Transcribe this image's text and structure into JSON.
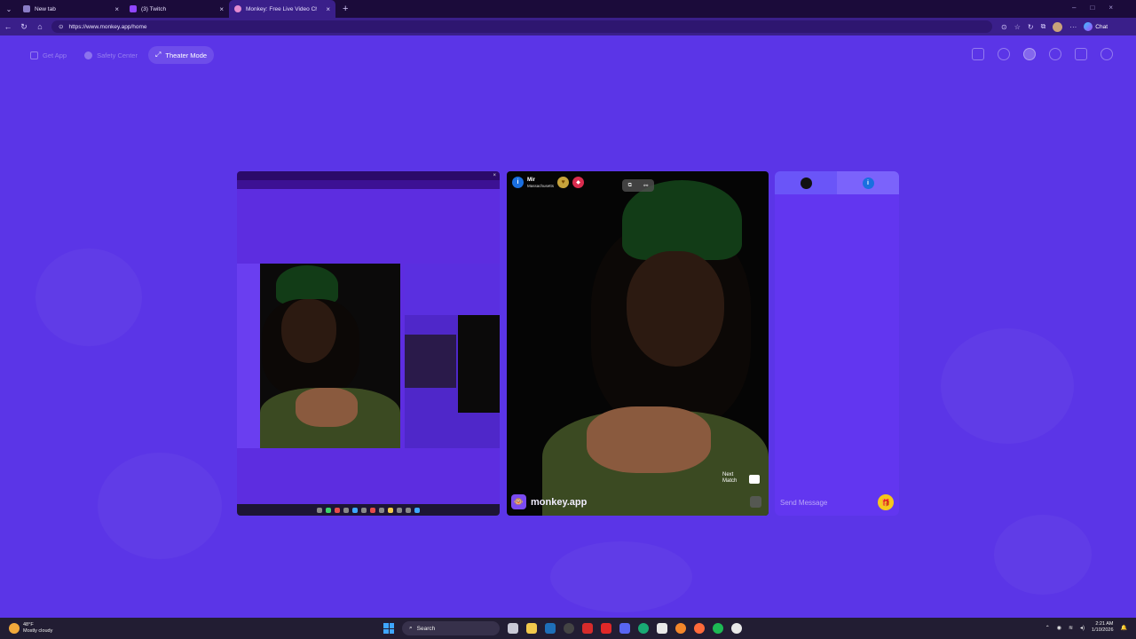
{
  "browser": {
    "tabs": [
      {
        "label": "New tab",
        "active": false
      },
      {
        "label": "(3) Twitch",
        "active": false
      },
      {
        "label": "Monkey: Free Live Video Chat",
        "active": true
      }
    ],
    "url": "https://www.monkey.app/home",
    "chat_label": "Chat"
  },
  "topnav": {
    "get_app": "Get App",
    "safety_center": "Safety Center",
    "theater_mode": "Theater Mode"
  },
  "main_video": {
    "username": "Mir",
    "location": "Massachusetts",
    "next_match": "Next Match",
    "logo_text": "monkey.app"
  },
  "chat": {
    "placeholder": "Send Message"
  },
  "taskbar": {
    "temperature": "48°F",
    "weather": "Mostly cloudy",
    "search": "Search",
    "time": "2:21 AM",
    "date": "1/10/2026"
  },
  "colors": {
    "page_bg": "#5b35e7",
    "accent": "#6236f0",
    "gift": "#f6c71c"
  }
}
